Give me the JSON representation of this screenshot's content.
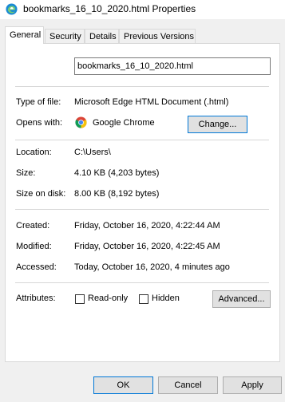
{
  "window": {
    "title": "bookmarks_16_10_2020.html Properties"
  },
  "tabs": [
    "General",
    "Security",
    "Details",
    "Previous Versions"
  ],
  "general": {
    "filename": "bookmarks_16_10_2020.html",
    "type_label": "Type of file:",
    "type_value": "Microsoft Edge HTML Document (.html)",
    "opens_label": "Opens with:",
    "opens_value": "Google Chrome",
    "change_button": "Change...",
    "location_label": "Location:",
    "location_value": "C:\\Users\\",
    "size_label": "Size:",
    "size_value": "4.10 KB (4,203 bytes)",
    "size_disk_label": "Size on disk:",
    "size_disk_value": "8.00 KB (8,192 bytes)",
    "created_label": "Created:",
    "created_value": "Friday, October 16, 2020, 4:22:44 AM",
    "modified_label": "Modified:",
    "modified_value": "Friday, October 16, 2020, 4:22:45 AM",
    "accessed_label": "Accessed:",
    "accessed_value": "Today, October 16, 2020, 4 minutes ago",
    "attributes_label": "Attributes:",
    "readonly_label": "Read-only",
    "readonly_checked": false,
    "hidden_label": "Hidden",
    "hidden_checked": false,
    "advanced_button": "Advanced..."
  },
  "footer": {
    "ok": "OK",
    "cancel": "Cancel",
    "apply": "Apply"
  },
  "colors": {
    "accent": "#0078d7",
    "window_bg": "#f0f0f0",
    "panel_bg": "#ffffff"
  },
  "icons": {
    "app": "edge-icon",
    "opens_with": "chrome-icon"
  }
}
